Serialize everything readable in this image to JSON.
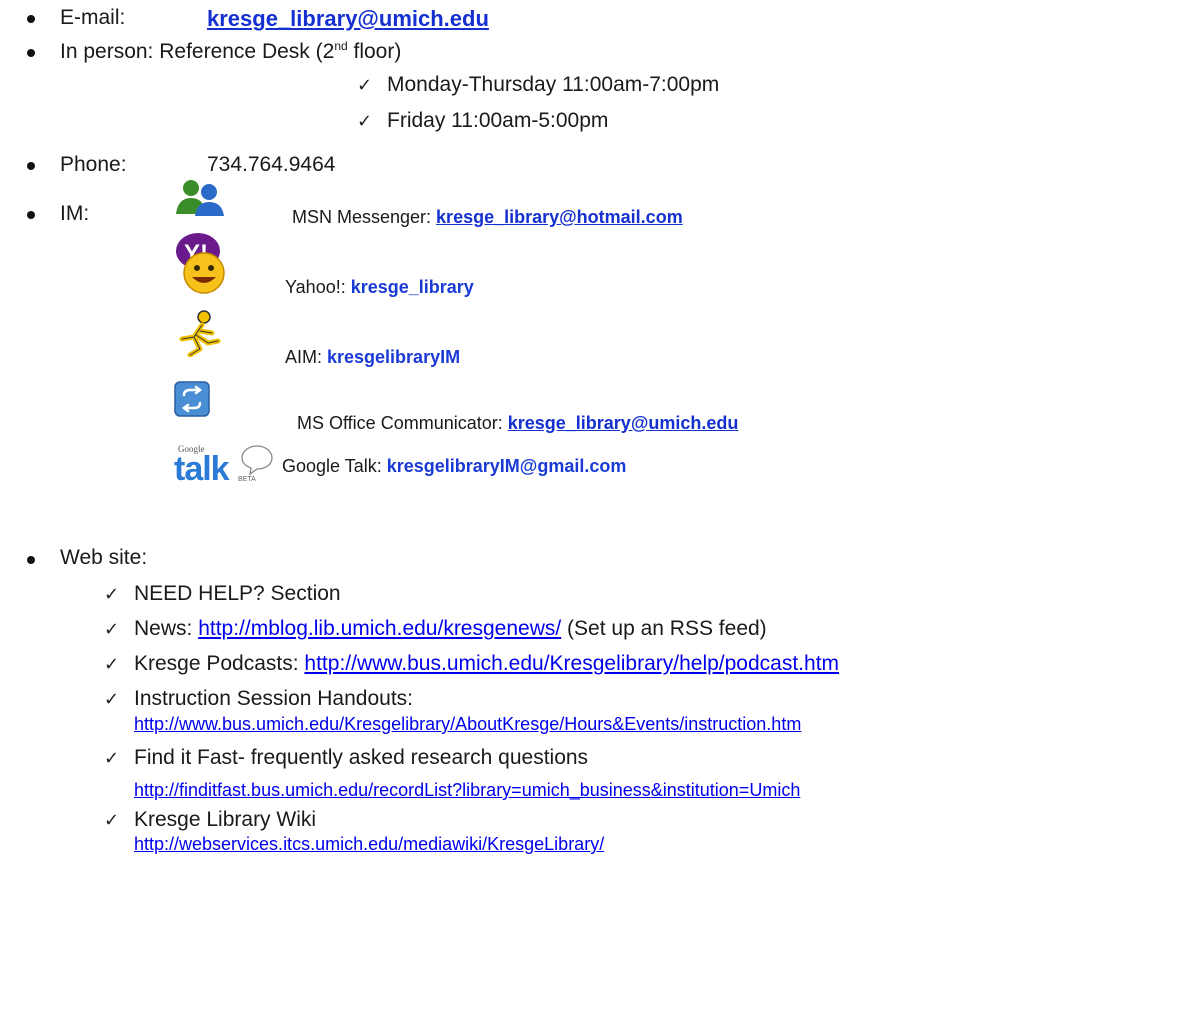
{
  "email": {
    "label": "E-mail:",
    "value": "kresge_library@umich.edu"
  },
  "in_person": {
    "label_pre": "In person:  Reference Desk (2",
    "label_sup": "nd",
    "label_post": " floor)",
    "hours": [
      "Monday-Thursday  11:00am-7:00pm",
      "Friday 11:00am-5:00pm"
    ]
  },
  "phone": {
    "label": "Phone:",
    "value": "734.764.9464"
  },
  "im": {
    "label": "IM:",
    "services": [
      {
        "icon": "msn-messenger-icon",
        "label": "MSN Messenger: ",
        "value": "kresge_library@hotmail.com"
      },
      {
        "icon": "yahoo-messenger-icon",
        "label": "Yahoo!: ",
        "value": "kresge_library"
      },
      {
        "icon": "aim-icon",
        "label": "AIM: ",
        "value": "kresgelibraryIM"
      },
      {
        "icon": "office-communicator-icon",
        "label": "MS Office Communicator: ",
        "value": "kresge_library@umich.edu"
      },
      {
        "icon": "google-talk-icon",
        "label": "Google Talk: ",
        "value": "kresgelibraryIM@gmail.com"
      }
    ],
    "google_talk_logo": {
      "small": "Google",
      "big": "talk",
      "beta": "BETA"
    },
    "yahoo_logo": "Y!"
  },
  "website": {
    "label": "Web site:",
    "items": [
      {
        "text": "NEED HELP? Section"
      },
      {
        "text": "News: ",
        "link": "http://mblog.lib.umich.edu/kresgenews/",
        "after": "  (Set up an RSS feed)"
      },
      {
        "text": "Kresge Podcasts:  ",
        "link": "http://www.bus.umich.edu/Kresgelibrary/help/podcast.htm"
      },
      {
        "text": "Instruction Session Handouts:",
        "link": "http://www.bus.umich.edu/Kresgelibrary/AboutKresge/Hours&Events/instruction.htm"
      },
      {
        "text": "Find it Fast- frequently asked research questions",
        "link": "http://finditfast.bus.umich.edu/recordList?library=umich_business&institution=Umich"
      },
      {
        "text": "Kresge Library Wiki",
        "link": "http://webservices.itcs.umich.edu/mediawiki/KresgeLibrary/"
      }
    ]
  },
  "check_glyph": "✓",
  "colors": {
    "link": "#0000ee",
    "bold_link": "#1a3ad6",
    "text": "#1a1a1a"
  }
}
